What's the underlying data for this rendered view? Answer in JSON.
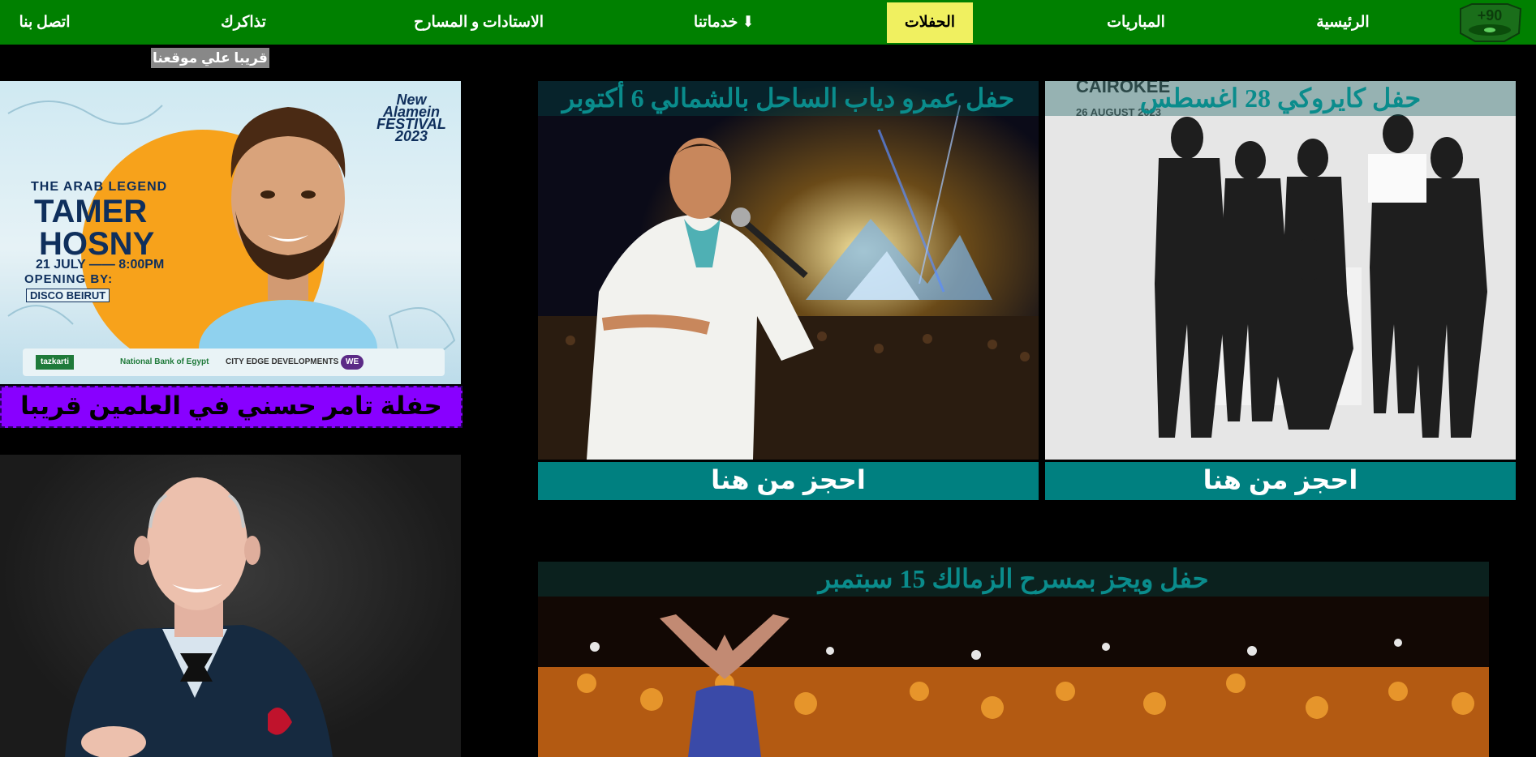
{
  "nav": {
    "logo_text": "+90",
    "items": [
      {
        "label": "الرئيسية"
      },
      {
        "label": "المباريات"
      },
      {
        "label": "الحفلات"
      },
      {
        "label": "خدماتنا ⬇"
      },
      {
        "label": "الاستادات و المسارح"
      },
      {
        "label": "تذاكرك"
      },
      {
        "label": "اتصل بنا"
      }
    ],
    "active": "الحفلات"
  },
  "soon_badge": "قريبا علي موقعنا",
  "tamer_poster": {
    "festival": "New Alamein FESTIVAL 2023",
    "tagline": "THE ARAB LEGEND",
    "name_line1": "TAMER",
    "name_line2": "HOSNY",
    "date": "21 JULY —— 8:00PM",
    "opening": "OPENING BY:",
    "opener": "DISCO BEIRUT",
    "sponsors": [
      "tazkarti",
      "National Bank of Egypt",
      "CITY EDGE DEVELOPMENTS",
      "WE"
    ],
    "caption": "حفلة تامر حسني في العلمين قريبا"
  },
  "concerts": [
    {
      "title": "حفل كايروكي 28 اغسطس",
      "book": "احجز من هنا",
      "photo_text": "CAIROKEE 26 AUGUST 2023"
    },
    {
      "title": "حفل عمرو دياب الساحل بالشمالي 6 أكتوبر",
      "book": "احجز من هنا"
    },
    {
      "title": "حفل ويجز بمسرح الزمالك 15 سبتمبر"
    }
  ],
  "colors": {
    "nav": "#008000",
    "active": "#f0f060",
    "book": "#008080",
    "title": "#0a8c8c",
    "caption_bg": "#8800ff"
  }
}
